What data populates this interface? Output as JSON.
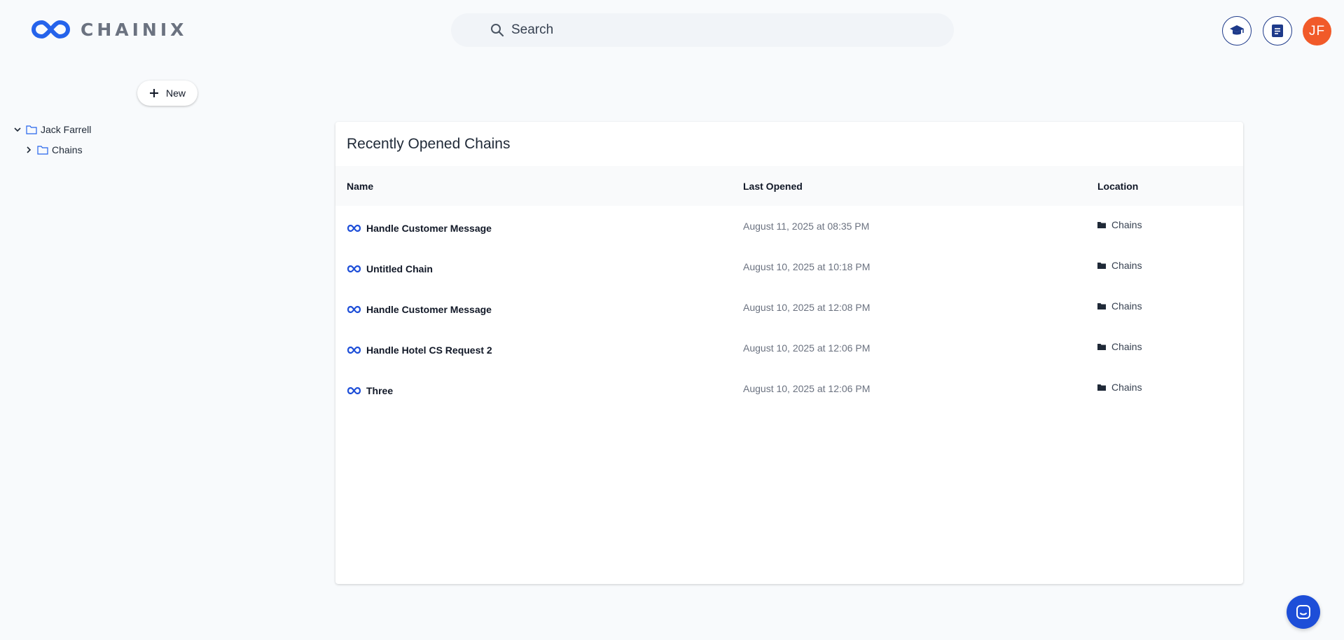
{
  "brand": {
    "name": "CHAINIX",
    "logo_color": "#2563eb"
  },
  "search": {
    "placeholder": "Search"
  },
  "header": {
    "buttons": [
      {
        "icon": "graduation-cap-icon"
      },
      {
        "icon": "document-icon"
      }
    ],
    "avatar": {
      "initials": "JF",
      "color": "#f15a29"
    }
  },
  "sidebar": {
    "new_label": "New",
    "tree": [
      {
        "label": "Jack Farrell",
        "expanded": true,
        "level": 0
      },
      {
        "label": "Chains",
        "expanded": false,
        "level": 1
      }
    ]
  },
  "recent": {
    "title": "Recently Opened Chains",
    "columns": [
      "Name",
      "Last Opened",
      "Location"
    ],
    "rows": [
      {
        "name": "Handle Customer Message",
        "last_opened": "August 11, 2025 at 08:35 PM",
        "location": "Chains"
      },
      {
        "name": "Untitled Chain",
        "last_opened": "August 10, 2025 at 10:18 PM",
        "location": "Chains"
      },
      {
        "name": "Handle Customer Message",
        "last_opened": "August 10, 2025 at 12:08 PM",
        "location": "Chains"
      },
      {
        "name": "Handle Hotel CS Request 2",
        "last_opened": "August 10, 2025 at 12:06 PM",
        "location": "Chains"
      },
      {
        "name": "Three",
        "last_opened": "August 10, 2025 at 12:06 PM",
        "location": "Chains"
      }
    ]
  },
  "chat": {
    "icon": "chat-icon",
    "color": "#1d4ed8"
  }
}
